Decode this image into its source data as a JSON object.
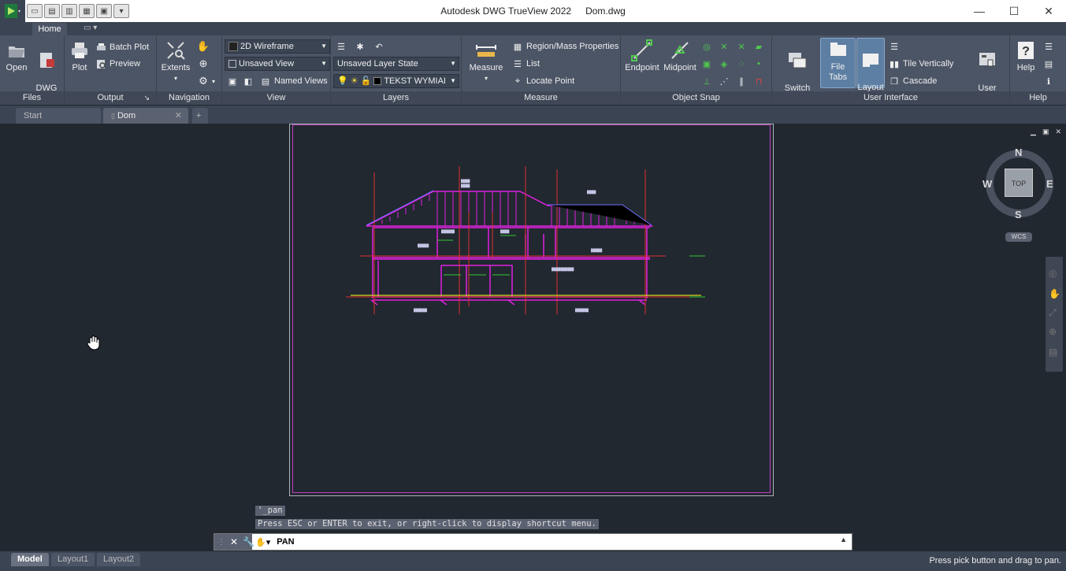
{
  "window": {
    "app_title": "Autodesk DWG TrueView 2022",
    "file_name": "Dom.dwg"
  },
  "ribbon_tabs": {
    "home": "Home"
  },
  "panels": {
    "files": {
      "title": "Files",
      "open": "Open",
      "dwg_convert": "DWG\nConvert"
    },
    "output": {
      "title": "Output",
      "plot": "Plot",
      "batch_plot": "Batch Plot",
      "preview": "Preview"
    },
    "navigation": {
      "title": "Navigation",
      "extents": "Extents"
    },
    "view": {
      "title": "View",
      "visual_style": "2D Wireframe",
      "saved_view": "Unsaved View",
      "named_views": "Named Views"
    },
    "layers": {
      "title": "Layers",
      "layer_state": "Unsaved Layer State",
      "current_layer": "TEKST WYMIAI"
    },
    "measure": {
      "title": "Measure",
      "measure": "Measure",
      "region_mass": "Region/Mass Properties",
      "list": "List",
      "locate_point": "Locate Point"
    },
    "object_snap": {
      "title": "Object Snap",
      "endpoint": "Endpoint",
      "midpoint": "Midpoint"
    },
    "user_interface": {
      "title": "User Interface",
      "switch_windows": "Switch\nWindows",
      "file_tabs": "File Tabs",
      "layout_tabs": "Layout\nTabs",
      "tile_vertically": "Tile Vertically",
      "cascade": "Cascade",
      "user_interface": "User\nInterface"
    },
    "help": {
      "title": "Help",
      "help": "Help"
    }
  },
  "doc_tabs": {
    "start": "Start",
    "dom": "Dom"
  },
  "viewcube": {
    "n": "N",
    "s": "S",
    "e": "E",
    "w": "W",
    "face": "TOP",
    "wcs": "WCS"
  },
  "command": {
    "history_1": "'_pan",
    "history_2": "Press ESC or ENTER to exit, or right-click to display shortcut menu.",
    "current": "PAN"
  },
  "layout_tabs": {
    "model": "Model",
    "layout1": "Layout1",
    "layout2": "Layout2"
  },
  "status": {
    "message": "Press pick button and drag to pan."
  },
  "colors": {
    "accent": "#5d7fa3",
    "drawing_magenta": "#e020e0",
    "drawing_red": "#e03030",
    "background": "#212830"
  }
}
